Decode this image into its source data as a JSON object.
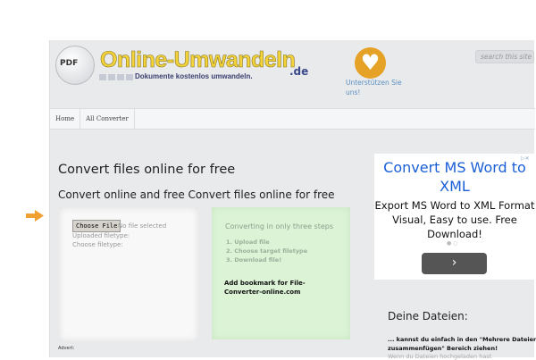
{
  "header": {
    "logo_icon_text": "PDF",
    "logo_title": "Online-Umwandeln",
    "logo_tld": ".de",
    "logo_subtitle": "Dokumente kostenlos umwandeln.",
    "support_text": "Unterstützen Sie uns!",
    "search_placeholder": "search this site"
  },
  "nav": {
    "items": [
      {
        "label": "Home"
      },
      {
        "label": "All Converter"
      }
    ]
  },
  "main": {
    "title": "Convert files online for free",
    "subtitle": "Convert online and free Convert files online for free",
    "upload": {
      "button": "Choose File",
      "status": "No file selected",
      "uploaded_label": "Uploaded filetype:",
      "choose_label": "Choose filetype:"
    },
    "steps": {
      "title": "Converting in only three steps",
      "items": [
        "1. Upload file",
        "2. Choose target filetype",
        "3. Download file!"
      ],
      "bookmark": "Add bookmark for File-Converter-online.com"
    },
    "advert_label": "Advert:"
  },
  "ad": {
    "title": "Convert MS Word to XML",
    "body": "Export MS Word to XML Format Visual, Easy to use. Free Download!",
    "dots": "● ○",
    "button": "›",
    "close": "▷✕"
  },
  "files": {
    "title": "Deine Dateien:",
    "text": "... kannst du einfach in den \"Mehrere Dateien zusammenfügen\" Bereich ziehen!",
    "more": "Wenn du Dateien hochgeladen hast"
  },
  "colors": {
    "accent": "#e5a226",
    "ad_link": "#1a5fd6",
    "steps_bg": "#dcf3d6"
  }
}
